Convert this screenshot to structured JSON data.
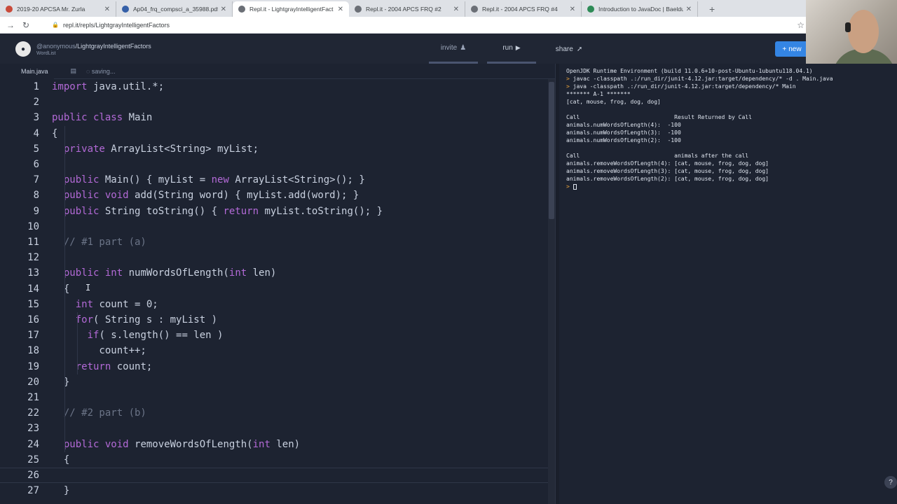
{
  "browser": {
    "tabs": [
      {
        "title": "2019-20 APCSA Mr. Zurla",
        "active": false
      },
      {
        "title": "Ap04_frq_compsci_a_35988.pdf",
        "active": false
      },
      {
        "title": "Repl.it - LightgrayIntelligentFact",
        "active": true
      },
      {
        "title": "Repl.it - 2004 APCS FRQ #2",
        "active": false
      },
      {
        "title": "Repl.it - 2004 APCS FRQ #4",
        "active": false
      },
      {
        "title": "Introduction to JavaDoc | Baeldu",
        "active": false
      }
    ],
    "url": "repl.it/repls/LightgrayIntelligentFactors"
  },
  "repl": {
    "user": "@anonymous",
    "name": "/LightgrayIntelligentFactors",
    "subtitle": "WordList",
    "invite_label": "invite",
    "run_label": "run",
    "share_label": "share",
    "new_label": "new"
  },
  "editor": {
    "file_name": "Main.java",
    "status": "saving...",
    "lines": [
      {
        "n": "1",
        "html": "<span class=\"kw\">import</span> java.util.*;"
      },
      {
        "n": "2",
        "html": ""
      },
      {
        "n": "3",
        "html": "<span class=\"kw\">public</span> <span class=\"kw\">class</span> Main"
      },
      {
        "n": "4",
        "html": "{"
      },
      {
        "n": "5",
        "html": "  <span class=\"kw\">private</span> ArrayList&lt;String&gt; myList;"
      },
      {
        "n": "6",
        "html": ""
      },
      {
        "n": "7",
        "html": "  <span class=\"kw\">public</span> Main() { myList = <span class=\"kw\">new</span> ArrayList&lt;String&gt;(); }"
      },
      {
        "n": "8",
        "html": "  <span class=\"kw\">public</span> <span class=\"kw\">void</span> add(String word) { myList.add(word); }"
      },
      {
        "n": "9",
        "html": "  <span class=\"kw\">public</span> String toString() { <span class=\"kw\">return</span> myList.toString(); }"
      },
      {
        "n": "10",
        "html": ""
      },
      {
        "n": "11",
        "html": "  <span class=\"cm\">// #1 part (a)</span>"
      },
      {
        "n": "12",
        "html": ""
      },
      {
        "n": "13",
        "html": "  <span class=\"kw\">public</span> <span class=\"kw\">int</span> numWordsOfLength(<span class=\"kw\">int</span> len)"
      },
      {
        "n": "14",
        "html": "  {"
      },
      {
        "n": "15",
        "html": "    <span class=\"kw\">int</span> count = 0;"
      },
      {
        "n": "16",
        "html": "    <span class=\"kw\">for</span>( String s : myList )"
      },
      {
        "n": "17",
        "html": "      <span class=\"kw\">if</span>( s.length() == len )"
      },
      {
        "n": "18",
        "html": "        count++;"
      },
      {
        "n": "19",
        "html": "    <span class=\"kw\">return</span> count;"
      },
      {
        "n": "20",
        "html": "  }"
      },
      {
        "n": "21",
        "html": ""
      },
      {
        "n": "22",
        "html": "  <span class=\"cm\">// #2 part (b)</span>"
      },
      {
        "n": "23",
        "html": ""
      },
      {
        "n": "24",
        "html": "  <span class=\"kw\">public</span> <span class=\"kw\">void</span> removeWordsOfLength(<span class=\"kw\">int</span> len)"
      },
      {
        "n": "25",
        "html": "  {"
      },
      {
        "n": "26",
        "html": ""
      },
      {
        "n": "27",
        "html": "  }"
      }
    ]
  },
  "console": {
    "lines": [
      "OpenJDK Runtime Environment (build 11.0.6+10-post-Ubuntu-1ubuntu118.04.1)",
      "> javac -classpath .:/run_dir/junit-4.12.jar:target/dependency/* -d . Main.java",
      "> java -classpath .:/run_dir/junit-4.12.jar:target/dependency/* Main",
      "******* A-1 *******",
      "[cat, mouse, frog, dog, dog]",
      "",
      "Call                            Result Returned by Call",
      "animals.numWordsOfLength(4):  -100",
      "animals.numWordsOfLength(3):  -100",
      "animals.numWordsOfLength(2):  -100",
      "",
      "Call                            animals after the call",
      "animals.removeWordsOfLength(4): [cat, mouse, frog, dog, dog]",
      "animals.removeWordsOfLength(3): [cat, mouse, frog, dog, dog]",
      "animals.removeWordsOfLength(2): [cat, mouse, frog, dog, dog]"
    ]
  }
}
